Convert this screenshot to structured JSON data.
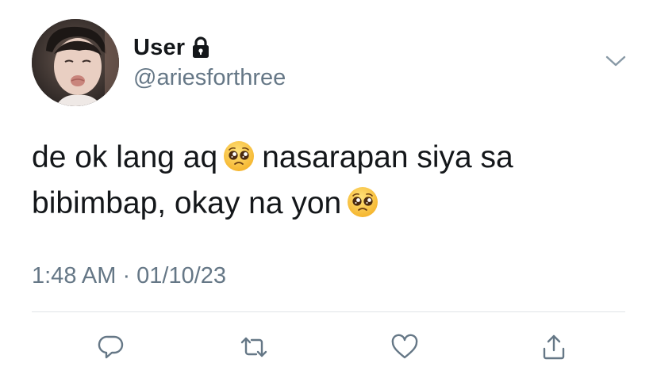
{
  "user": {
    "display_name": "User",
    "handle": "@ariesforthree",
    "protected": true
  },
  "tweet": {
    "line1_part1": "de ok lang aq",
    "line1_emoji": "pleading-face-emoji",
    "line1_part2": "nasarapan siya sa",
    "line2_text": "bibimbap, okay na yon",
    "line2_emoji": "pleading-face-emoji"
  },
  "meta": {
    "timestamp": "1:48 AM · 01/10/23"
  },
  "icons": {
    "lock": "lock-icon",
    "menu": "chevron-down-icon",
    "reply": "reply-icon",
    "retweet": "retweet-icon",
    "like": "heart-icon",
    "share": "share-icon"
  },
  "colors": {
    "text": "#14171a",
    "secondary": "#657786",
    "divider": "#dfe3e7",
    "action_icon": "#657786"
  }
}
